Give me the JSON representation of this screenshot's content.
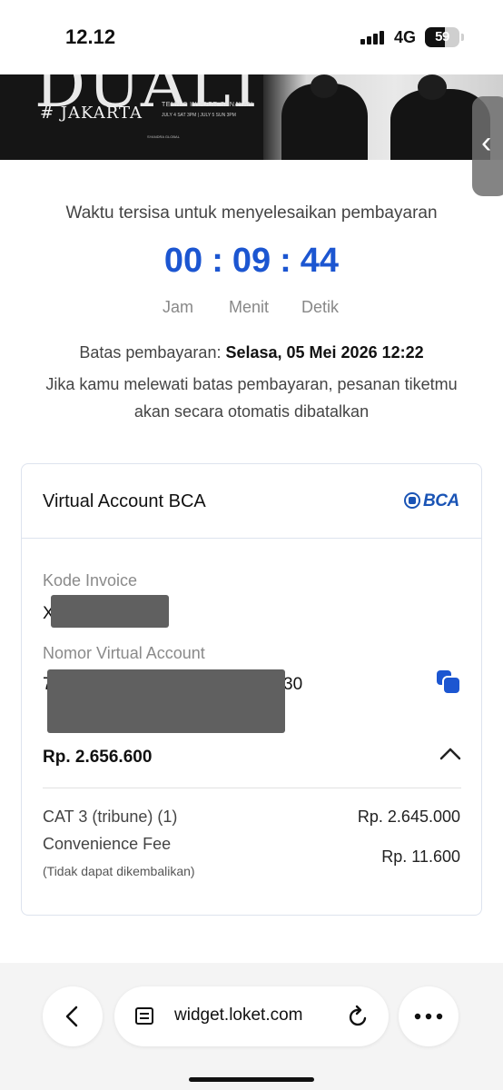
{
  "status": {
    "time": "12.12",
    "network": "4G",
    "battery": "59"
  },
  "banner": {
    "title": "DUALITY",
    "city": "# JAKARTA",
    "venue": "TENNIS INDOOR SENAYAN",
    "dates": "JULY 4 SAT 3PM | JULY 5 SUN 3PM",
    "sponsor": "SYANDRA GLOBAL"
  },
  "timer": {
    "label": "Waktu tersisa untuk menyelesaikan pembayaran",
    "hours": "00",
    "minutes": "09",
    "seconds": "44",
    "separator": ":",
    "unit_hours": "Jam",
    "unit_minutes": "Menit",
    "unit_seconds": "Detik"
  },
  "deadline": {
    "prefix": "Batas pembayaran: ",
    "value": "Selasa, 05 Mei 2026 12:22",
    "warning": "Jika kamu melewati batas pembayaran, pesanan tiketmu akan secara otomatis dibatalkan"
  },
  "payment": {
    "method": "Virtual Account BCA",
    "bank_logo": "BCA",
    "invoice_label": "Kode Invoice",
    "invoice_value_visible": "X",
    "va_label": "Nomor Virtual Account",
    "va_value_start": "7",
    "va_value_end": "30",
    "total_value": "Rp. 2.656.600",
    "items": [
      {
        "label": "CAT 3 (tribune) (1)",
        "amount": "Rp. 2.645.000"
      },
      {
        "label": "Convenience Fee",
        "amount": "Rp. 11.600"
      }
    ],
    "note": "(Tidak dapat dikembalikan)"
  },
  "browser": {
    "url": "widget.loket.com"
  },
  "icons": {
    "back": "chevron-left-icon",
    "reader": "reader-icon",
    "reload": "reload-icon",
    "more": "more-icon",
    "copy": "copy-icon",
    "collapse": "chevron-up-icon"
  },
  "colors": {
    "accent": "#1c56d1",
    "bca": "#1a54b5"
  }
}
